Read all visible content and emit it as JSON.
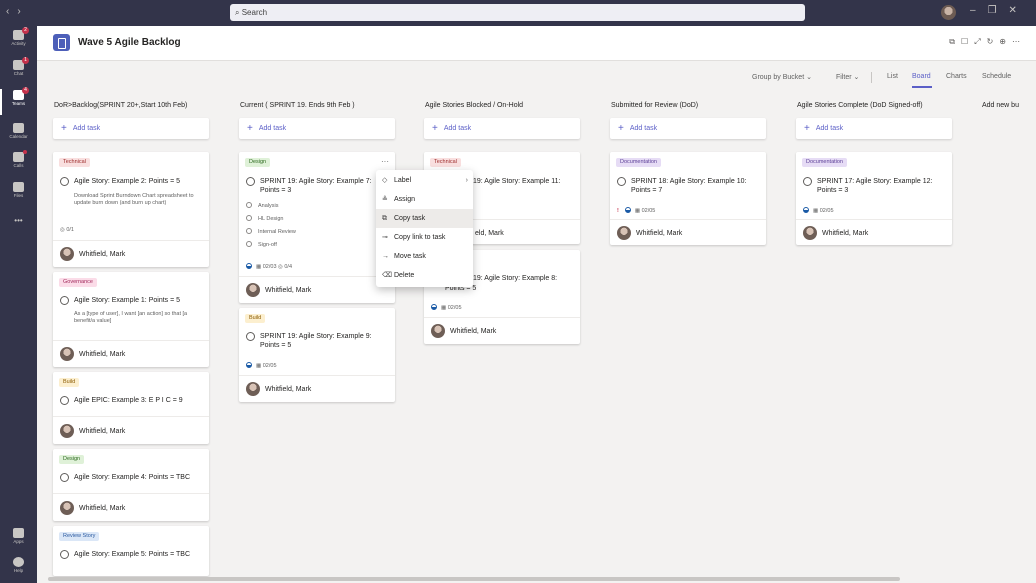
{
  "topbar": {
    "search_placeholder": "Search",
    "nav_icons": [
      "back-arrow",
      "forward-arrow"
    ],
    "window_buttons": [
      "–",
      "❐",
      "✕"
    ]
  },
  "rail": {
    "items": [
      {
        "label": "Activity",
        "badge": "2"
      },
      {
        "label": "Chat",
        "badge": "1"
      },
      {
        "label": "Teams",
        "badge": "4",
        "active": true
      },
      {
        "label": "Calendar"
      },
      {
        "label": "Calls"
      },
      {
        "label": "Files"
      },
      {
        "label": "•••"
      },
      {
        "label": "Apps"
      },
      {
        "label": "Help"
      }
    ]
  },
  "header": {
    "title": "Wave 5 Agile Backlog",
    "icons": [
      "popout-icon",
      "chat-icon",
      "expand-icon",
      "refresh-icon",
      "globe-icon",
      "more-icon"
    ]
  },
  "toolbar": {
    "group_by": "Group by Bucket",
    "filter": "Filter",
    "views": [
      "List",
      "Board",
      "Charts",
      "Schedule"
    ],
    "active_view": "Board"
  },
  "add_task_label": "Add task",
  "add_new_bucket": "Add new bu",
  "buckets": [
    {
      "title": "DoR>Backlog(SPRINT 20+,Start 10th Feb)",
      "cards": [
        {
          "label": "Technical",
          "title": "Agile Story: Example 2: Points = 5",
          "desc": "Download Sprint Burndown Chart spreadsheet to update burn down (and burn up chart)",
          "meta": "0/1",
          "assignee": "Whitfield, Mark"
        },
        {
          "label": "Governance",
          "title": "Agile Story: Example 1: Points = 5",
          "desc": "As a [type of user], I want [an action] so that [a benefit/a value]",
          "assignee": "Whitfield, Mark"
        },
        {
          "label": "Build",
          "title": "Agile EPIC: Example 3: E P I C = 9",
          "assignee": "Whitfield, Mark"
        },
        {
          "label": "Design",
          "title": "Agile Story: Example 4: Points = TBC",
          "assignee": "Whitfield, Mark"
        },
        {
          "label": "Review Story",
          "title": "Agile Story: Example 5: Points = TBC"
        }
      ]
    },
    {
      "title": "Current ( SPRINT 19. Ends 9th Feb )",
      "cards": [
        {
          "label": "Design",
          "title": "SPRINT 19: Agile Story: Example 7: Points = 3",
          "checklist": [
            "Analysis",
            "HL Design",
            "Internal Review",
            "Sign-off"
          ],
          "date": "02/03",
          "checks": "0/4",
          "assignee": "Whitfield, Mark"
        },
        {
          "label": "Build",
          "title": "SPRINT 19: Agile Story: Example 9: Points = 5",
          "date": "02/05",
          "assignee": "Whitfield, Mark"
        }
      ]
    },
    {
      "title": "Agile Stories Blocked / On-Hold",
      "cards": [
        {
          "label": "Technical",
          "title": "19: Agile Story: Example 11:",
          "assignee_tail": "eld, Mark"
        },
        {
          "title": "19: Agile Story: Example 8:",
          "title2": "Points = 5",
          "date": "02/05",
          "assignee": "Whitfield, Mark"
        }
      ]
    },
    {
      "title": "Submitted for Review (DoD)",
      "cards": [
        {
          "label": "Documentation",
          "title": "SPRINT 18: Agile Story: Example 10: Points = 7",
          "urgent": "!",
          "date": "02/05",
          "assignee": "Whitfield, Mark"
        }
      ]
    },
    {
      "title": "Agile Stories Complete (DoD Signed-off)",
      "cards": [
        {
          "label": "Documentation",
          "title": "SPRINT 17: Agile Story: Example 12: Points = 3",
          "date": "02/05",
          "assignee": "Whitfield, Mark"
        }
      ]
    }
  ],
  "context_menu": {
    "items": [
      {
        "label": "Label",
        "icon": "tag-icon",
        "submenu": true
      },
      {
        "label": "Assign",
        "icon": "assign-icon"
      },
      {
        "label": "Copy task",
        "icon": "copy-icon",
        "highlighted": true
      },
      {
        "label": "Copy link to task",
        "icon": "link-icon"
      },
      {
        "label": "Move task",
        "icon": "move-arrow-icon"
      },
      {
        "label": "Delete",
        "icon": "trash-icon"
      }
    ]
  }
}
